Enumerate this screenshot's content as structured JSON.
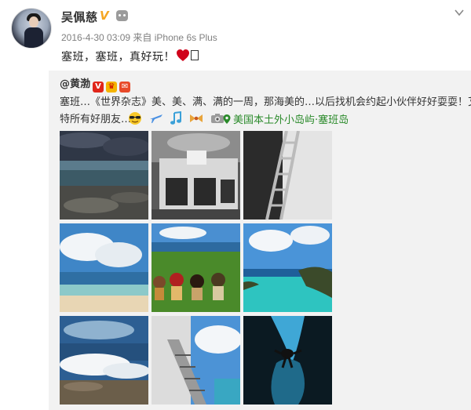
{
  "post": {
    "author": "吴佩慈",
    "meta": "2016-4-30 03:09  来自 iPhone 6s Plus",
    "text": "塞班，塞班，真好玩！"
  },
  "repost": {
    "mention": "@黄渤",
    "line1": "塞班…《世界杂志》美、美、满、满的一周，那海美的…以后找机会约起小伙伴好好耍耍！艾",
    "line2": "特所有好朋友…",
    "location": "美国本土外小岛屿·塞班岛"
  },
  "icons": {
    "verified": "v-badge-icon",
    "robot": "robot-icon",
    "chevron": "chevron-down-icon",
    "heart": "heart-icon",
    "pin": "location-pin-icon"
  },
  "colors": {
    "accent_verified": "#f5a623",
    "heart": "#d0021b",
    "location": "#2a8a2a",
    "repost_bg": "#f2f2f2"
  },
  "photos": [
    {
      "name": "photo-stormy-beach"
    },
    {
      "name": "photo-bw-boat-cabin"
    },
    {
      "name": "photo-bw-ladder"
    },
    {
      "name": "photo-beach-clouds"
    },
    {
      "name": "photo-figurines-grass"
    },
    {
      "name": "photo-turquoise-cove"
    },
    {
      "name": "photo-crashing-waves"
    },
    {
      "name": "photo-boat-stairs"
    },
    {
      "name": "photo-underwater-cave-diver"
    }
  ]
}
